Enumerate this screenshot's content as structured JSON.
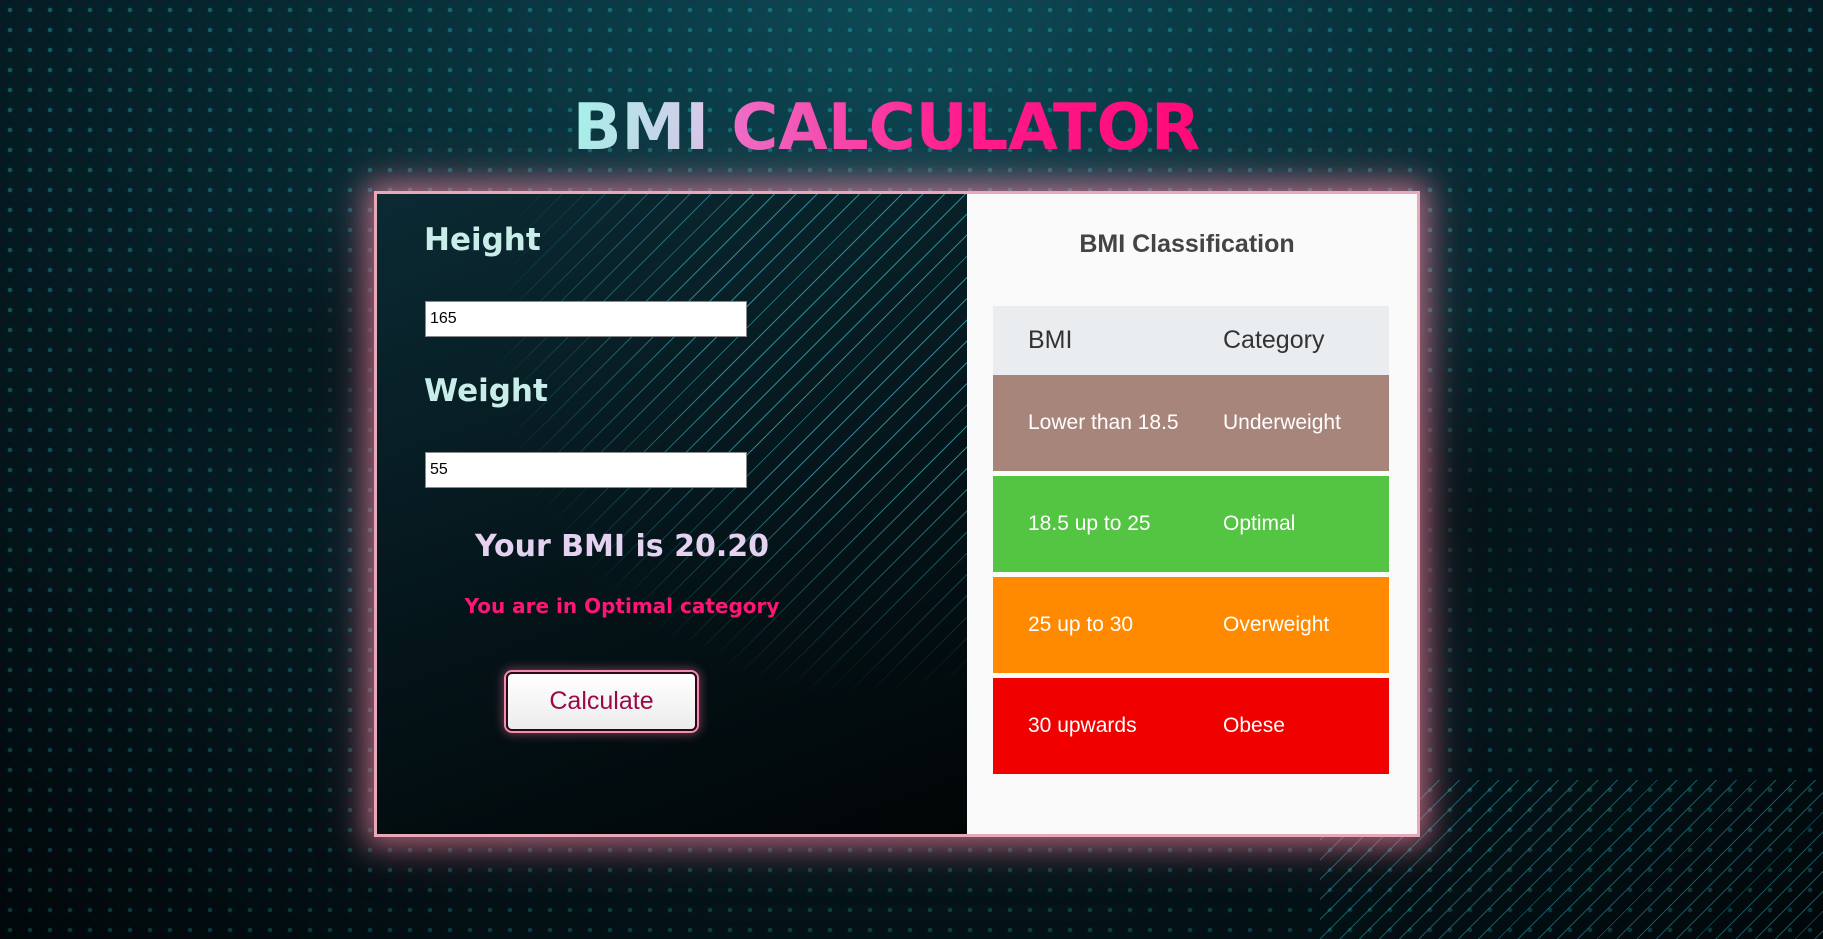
{
  "page": {
    "title_part1": "BMI",
    "title_part2": "CALCULATOR"
  },
  "form": {
    "height_label": "Height",
    "height_value": "165",
    "weight_label": "Weight",
    "weight_value": "55",
    "result_text": "Your BMI is 20.20",
    "category_text": "You are in Optimal category",
    "calculate_label": "Calculate"
  },
  "classification": {
    "title": "BMI Classification",
    "headers": [
      "BMI",
      "Category"
    ],
    "rows": [
      {
        "bmi": "Lower than 18.5",
        "category": "Underweight",
        "color": "#a8857b"
      },
      {
        "bmi": "18.5 up to 25",
        "category": "Optimal",
        "color": "#54c443"
      },
      {
        "bmi": "25 up to 30",
        "category": "Overweight",
        "color": "#ff8a00"
      },
      {
        "bmi": "30 upwards",
        "category": "Obese",
        "color": "#f10000"
      }
    ]
  },
  "colors": {
    "accent_pink": "#ff1574",
    "title_gradient_start": "#a6f1e9",
    "title_gradient_end": "#ff0a78",
    "glow": "#e6a9ba"
  }
}
